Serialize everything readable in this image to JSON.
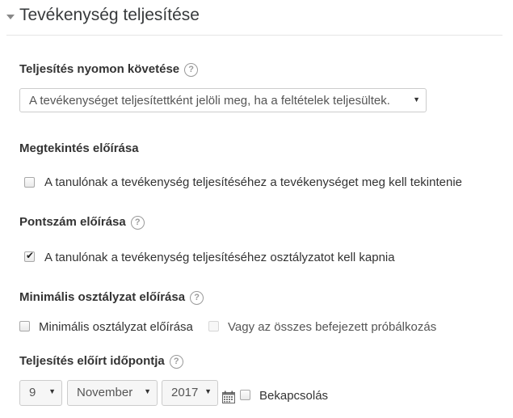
{
  "section": {
    "title": "Tevékenység teljesítése"
  },
  "completion_tracking": {
    "label": "Teljesítés nyomon követése",
    "help": "?",
    "selected": "A tevékenységet teljesítettként jelöli meg, ha a feltételek teljesültek."
  },
  "require_view": {
    "label": "Megtekintés előírása",
    "checkbox_label": "A tanulónak a tevékenység teljesítéséhez a tevékenységet meg kell tekintenie",
    "checked": false
  },
  "require_grade": {
    "label": "Pontszám előírása",
    "help": "?",
    "checkbox_label": "A tanulónak a tevékenység teljesítéséhez osztályzatot kell kapnia",
    "checked": true
  },
  "require_passing_grade": {
    "label": "Minimális osztályzat előírása",
    "help": "?",
    "checkbox_label": "Minimális osztályzat előírása",
    "checked": false,
    "alt_label": "Vagy az összes befejezett próbálkozás",
    "alt_checked": false
  },
  "expected_completion": {
    "label": "Teljesítés előírt időpontja",
    "help": "?",
    "day": "9",
    "month": "November",
    "year": "2017",
    "enable_label": "Bekapcsolás",
    "enabled": false,
    "calendar_icon": "calendar-icon"
  }
}
